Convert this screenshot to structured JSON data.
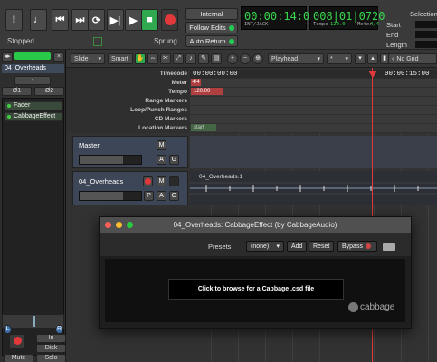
{
  "transport": {
    "buttons": [
      "!",
      "𝅘𝅥",
      "|◀",
      "◀|",
      "⟳",
      "▶|",
      "▶",
      "■"
    ],
    "status_left": "Stopped",
    "status_right": "Sprung",
    "internal_label": "Internal",
    "follow_edits_label": "Follow Edits",
    "auto_return_label": "Auto Return",
    "timecode": "00:00:14:05",
    "timecode_sub": "INT/JACK",
    "bbt": "008|01|0720",
    "tempo_label": "Tempo",
    "tempo_value": "120.0",
    "meter_label": "Meter",
    "meter_value": "4/4",
    "selection": {
      "title": "Selection",
      "start": "Start",
      "end": "End",
      "length": "Length"
    }
  },
  "sidebar": {
    "track_name": "04_Overheads",
    "in1": "Ø1",
    "in2": "Ø2",
    "items": [
      {
        "label": "Fader"
      },
      {
        "label": "CabbageEffect"
      }
    ],
    "left_label": "L",
    "right_label": "R",
    "in_label": "In",
    "disk_label": "Disk",
    "mute_label": "Mute",
    "solo_label": "Solo"
  },
  "toolbar": {
    "edit_mode": "Slide",
    "snap_mode": "Smart",
    "playhead_label": "Playhead",
    "grid_label": "No Grid",
    "marker_symbol": "*"
  },
  "rulers": {
    "labels": [
      "Timecode",
      "Meter",
      "Tempo",
      "Range Markers",
      "Loop/Punch Ranges",
      "CD Markers",
      "Location Markers"
    ],
    "timecode_start": "00:00:00:00",
    "timecode_mark": "00:00:15:00",
    "meter_chip": "4/4",
    "tempo_chip": "120.00",
    "start_chip": "start"
  },
  "tracks": [
    {
      "name": "Master",
      "buttons": [
        "M",
        "A",
        "G"
      ]
    },
    {
      "name": "04_Overheads",
      "buttons": [
        "M",
        "P",
        "A",
        "G"
      ],
      "region": "04_Overheads.1"
    }
  ],
  "plugin": {
    "title": "04_Overheads: CabbageEffect (by CabbageAudio)",
    "presets_label": "Presets",
    "preset_value": "(none)",
    "add_label": "Add",
    "reset_label": "Reset",
    "bypass_label": "Bypass",
    "browse_text": "Click to browse for a Cabbage .csd file",
    "logo_text": "cabbage"
  },
  "colors": {
    "accent_green": "#2fa84f",
    "record_red": "#e0383b",
    "clock_green": "#38d84c"
  }
}
